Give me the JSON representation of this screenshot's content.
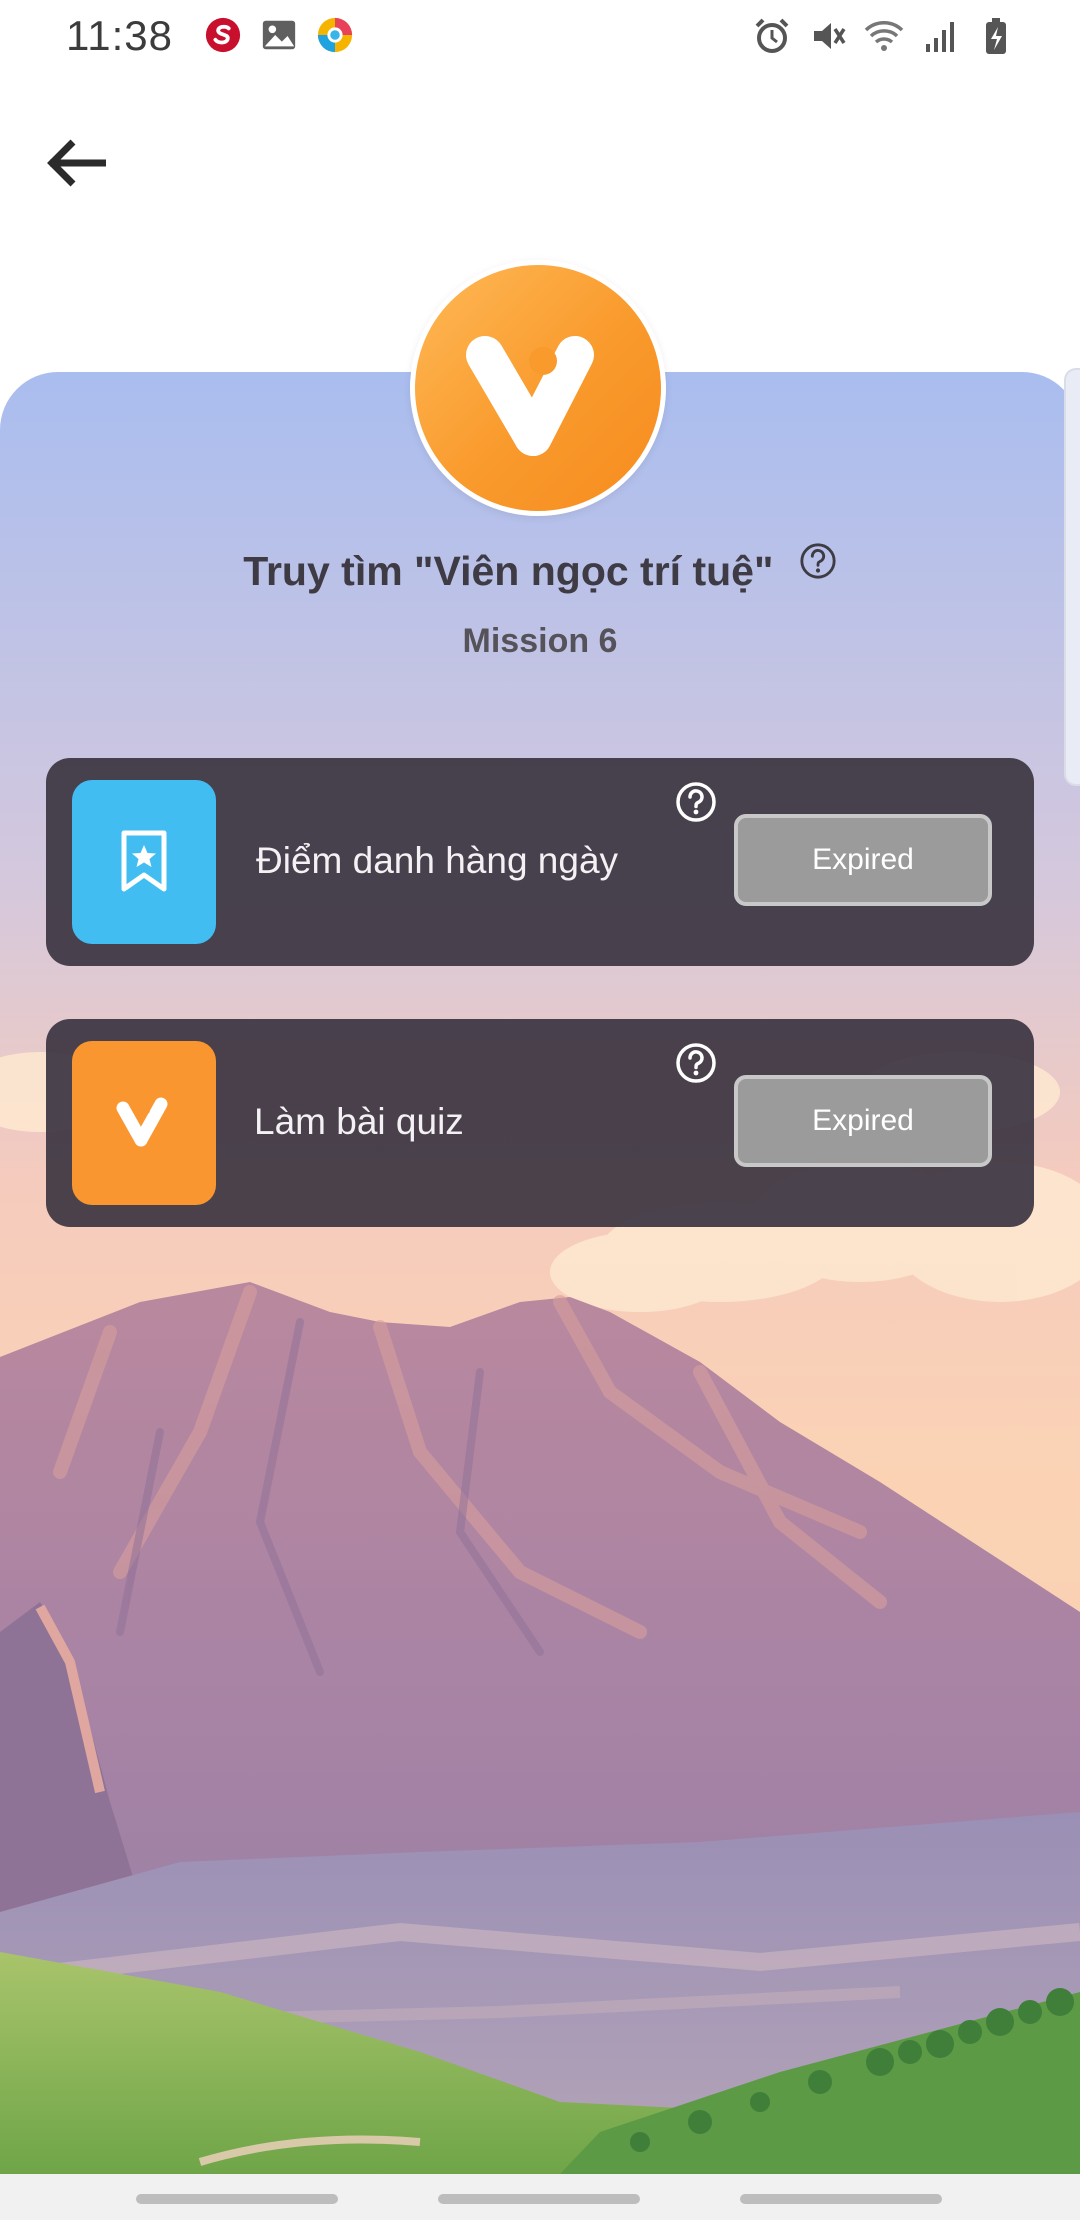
{
  "status_bar": {
    "time": "11:38",
    "app_icons": [
      "shopee-s-icon",
      "gallery-icon",
      "chrome-like-icon"
    ],
    "system_icons": [
      "alarm-icon",
      "mute-icon",
      "wifi-icon",
      "signal-icon",
      "battery-charging-icon"
    ]
  },
  "header": {
    "back_icon": "arrow-left-icon"
  },
  "mission": {
    "title": "Truy tìm \"Viên ngọc trí tuệ\"",
    "subtitle": "Mission 6",
    "logo_icon": "v-logo-icon",
    "help_icon": "question-circle-icon"
  },
  "tasks": [
    {
      "label": "Điểm danh hàng ngày",
      "icon": "bookmark-star-icon",
      "icon_color": "#42bdf2",
      "status": "Expired"
    },
    {
      "label": "Làm bài quiz",
      "icon": "v-logo-icon",
      "icon_color": "#fa9630",
      "status": "Expired"
    }
  ],
  "colors": {
    "brand_orange": "#f99a2c",
    "card_bg": "#3c3642",
    "expired_bg": "#9b9b9b"
  }
}
